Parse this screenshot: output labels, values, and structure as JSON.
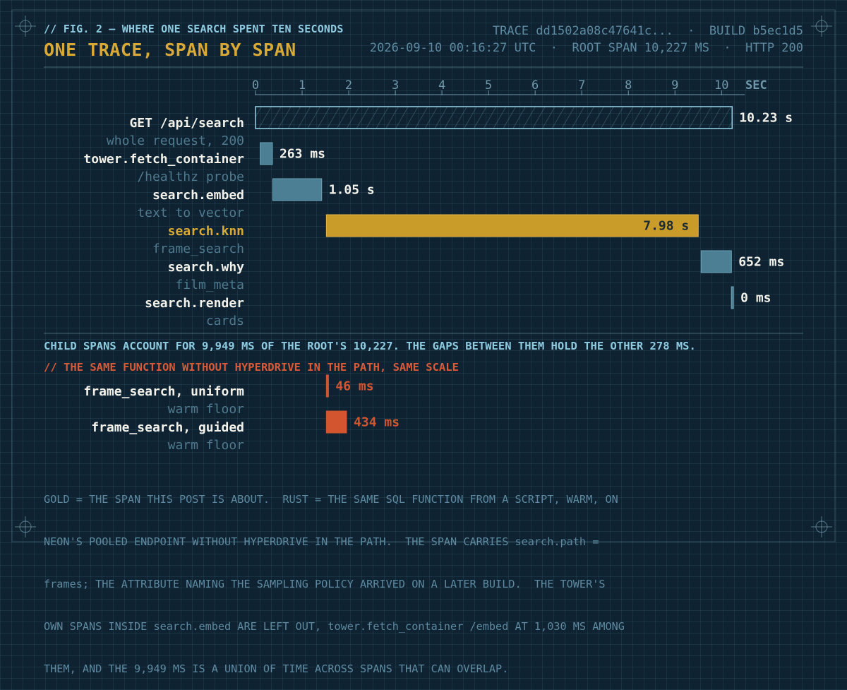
{
  "figure": {
    "label": "// FIG. 2 — WHERE ONE SEARCH SPENT TEN SECONDS",
    "title": "ONE TRACE, SPAN BY SPAN"
  },
  "meta": {
    "line1": "TRACE dd1502a08c47641c...  ·  BUILD b5ec1d5",
    "line2": "2026-09-10 00:16:27 UTC  ·  ROOT SPAN 10,227 MS  ·  HTTP 200"
  },
  "colors": {
    "background": "#0f2231",
    "bar_default": "#4c7f93",
    "bar_highlight": "#c99c29",
    "bar_compare": "#d2552f",
    "text_label": "#f2f2ea",
    "text_sub": "#4f7a8e",
    "accent_cyan": "#8ecbe0",
    "title_gold": "#d8a934"
  },
  "chart_data": [
    {
      "type": "bar",
      "orientation": "horizontal-timeline",
      "xlabel": "SEC",
      "xlim": [
        0,
        10.5
      ],
      "xticks": [
        "0",
        "1",
        "2",
        "3",
        "4",
        "5",
        "6",
        "7",
        "8",
        "9",
        "10"
      ],
      "spans": [
        {
          "name": "GET /api/search",
          "sub": "whole request, 200",
          "start": 0,
          "duration": 10.227,
          "label": "10.23 s",
          "style": "root"
        },
        {
          "name": "tower.fetch_container",
          "sub": "/healthz probe",
          "start": 0.1,
          "duration": 0.263,
          "label": "263 ms",
          "style": "normal"
        },
        {
          "name": "search.embed",
          "sub": "text to vector",
          "start": 0.37,
          "duration": 1.05,
          "label": "1.05 s",
          "style": "normal"
        },
        {
          "name": "search.knn",
          "sub": "frame_search",
          "start": 1.52,
          "duration": 7.98,
          "label": "7.98 s",
          "style": "highlight"
        },
        {
          "name": "search.why",
          "sub": "film_meta",
          "start": 9.56,
          "duration": 0.652,
          "label": "652 ms",
          "style": "normal"
        },
        {
          "name": "search.render",
          "sub": "cards",
          "start": 10.21,
          "duration": 0.0,
          "label": "0 ms",
          "style": "normal"
        }
      ]
    },
    {
      "type": "bar",
      "orientation": "horizontal-timeline",
      "title": "// THE SAME FUNCTION WITHOUT HYPERDRIVE IN THE PATH, SAME SCALE",
      "xlim": [
        0,
        10.5
      ],
      "spans": [
        {
          "name": "frame_search, uniform",
          "sub": "warm floor",
          "start": 1.52,
          "duration": 0.046,
          "label": "46 ms",
          "style": "compare"
        },
        {
          "name": "frame_search, guided",
          "sub": "warm floor",
          "start": 1.52,
          "duration": 0.434,
          "label": "434 ms",
          "style": "compare"
        }
      ]
    }
  ],
  "summary": "CHILD SPANS ACCOUNT FOR 9,949 MS OF THE ROOT'S 10,227. THE GAPS BETWEEN THEM HOLD THE OTHER 278 MS.",
  "note_lines": [
    "GOLD = THE SPAN THIS POST IS ABOUT.  RUST = THE SAME SQL FUNCTION FROM A SCRIPT, WARM, ON",
    "NEON'S POOLED ENDPOINT WITHOUT HYPERDRIVE IN THE PATH.  THE SPAN CARRIES search.path =",
    "frames; THE ATTRIBUTE NAMING THE SAMPLING POLICY ARRIVED ON A LATER BUILD.  THE TOWER'S",
    "OWN SPANS INSIDE search.embed ARE LEFT OUT, tower.fetch_container /embed AT 1,030 MS AMONG",
    "THEM, AND THE 9,949 MS IS A UNION OF TIME ACROSS SPANS THAT CAN OVERLAP."
  ]
}
